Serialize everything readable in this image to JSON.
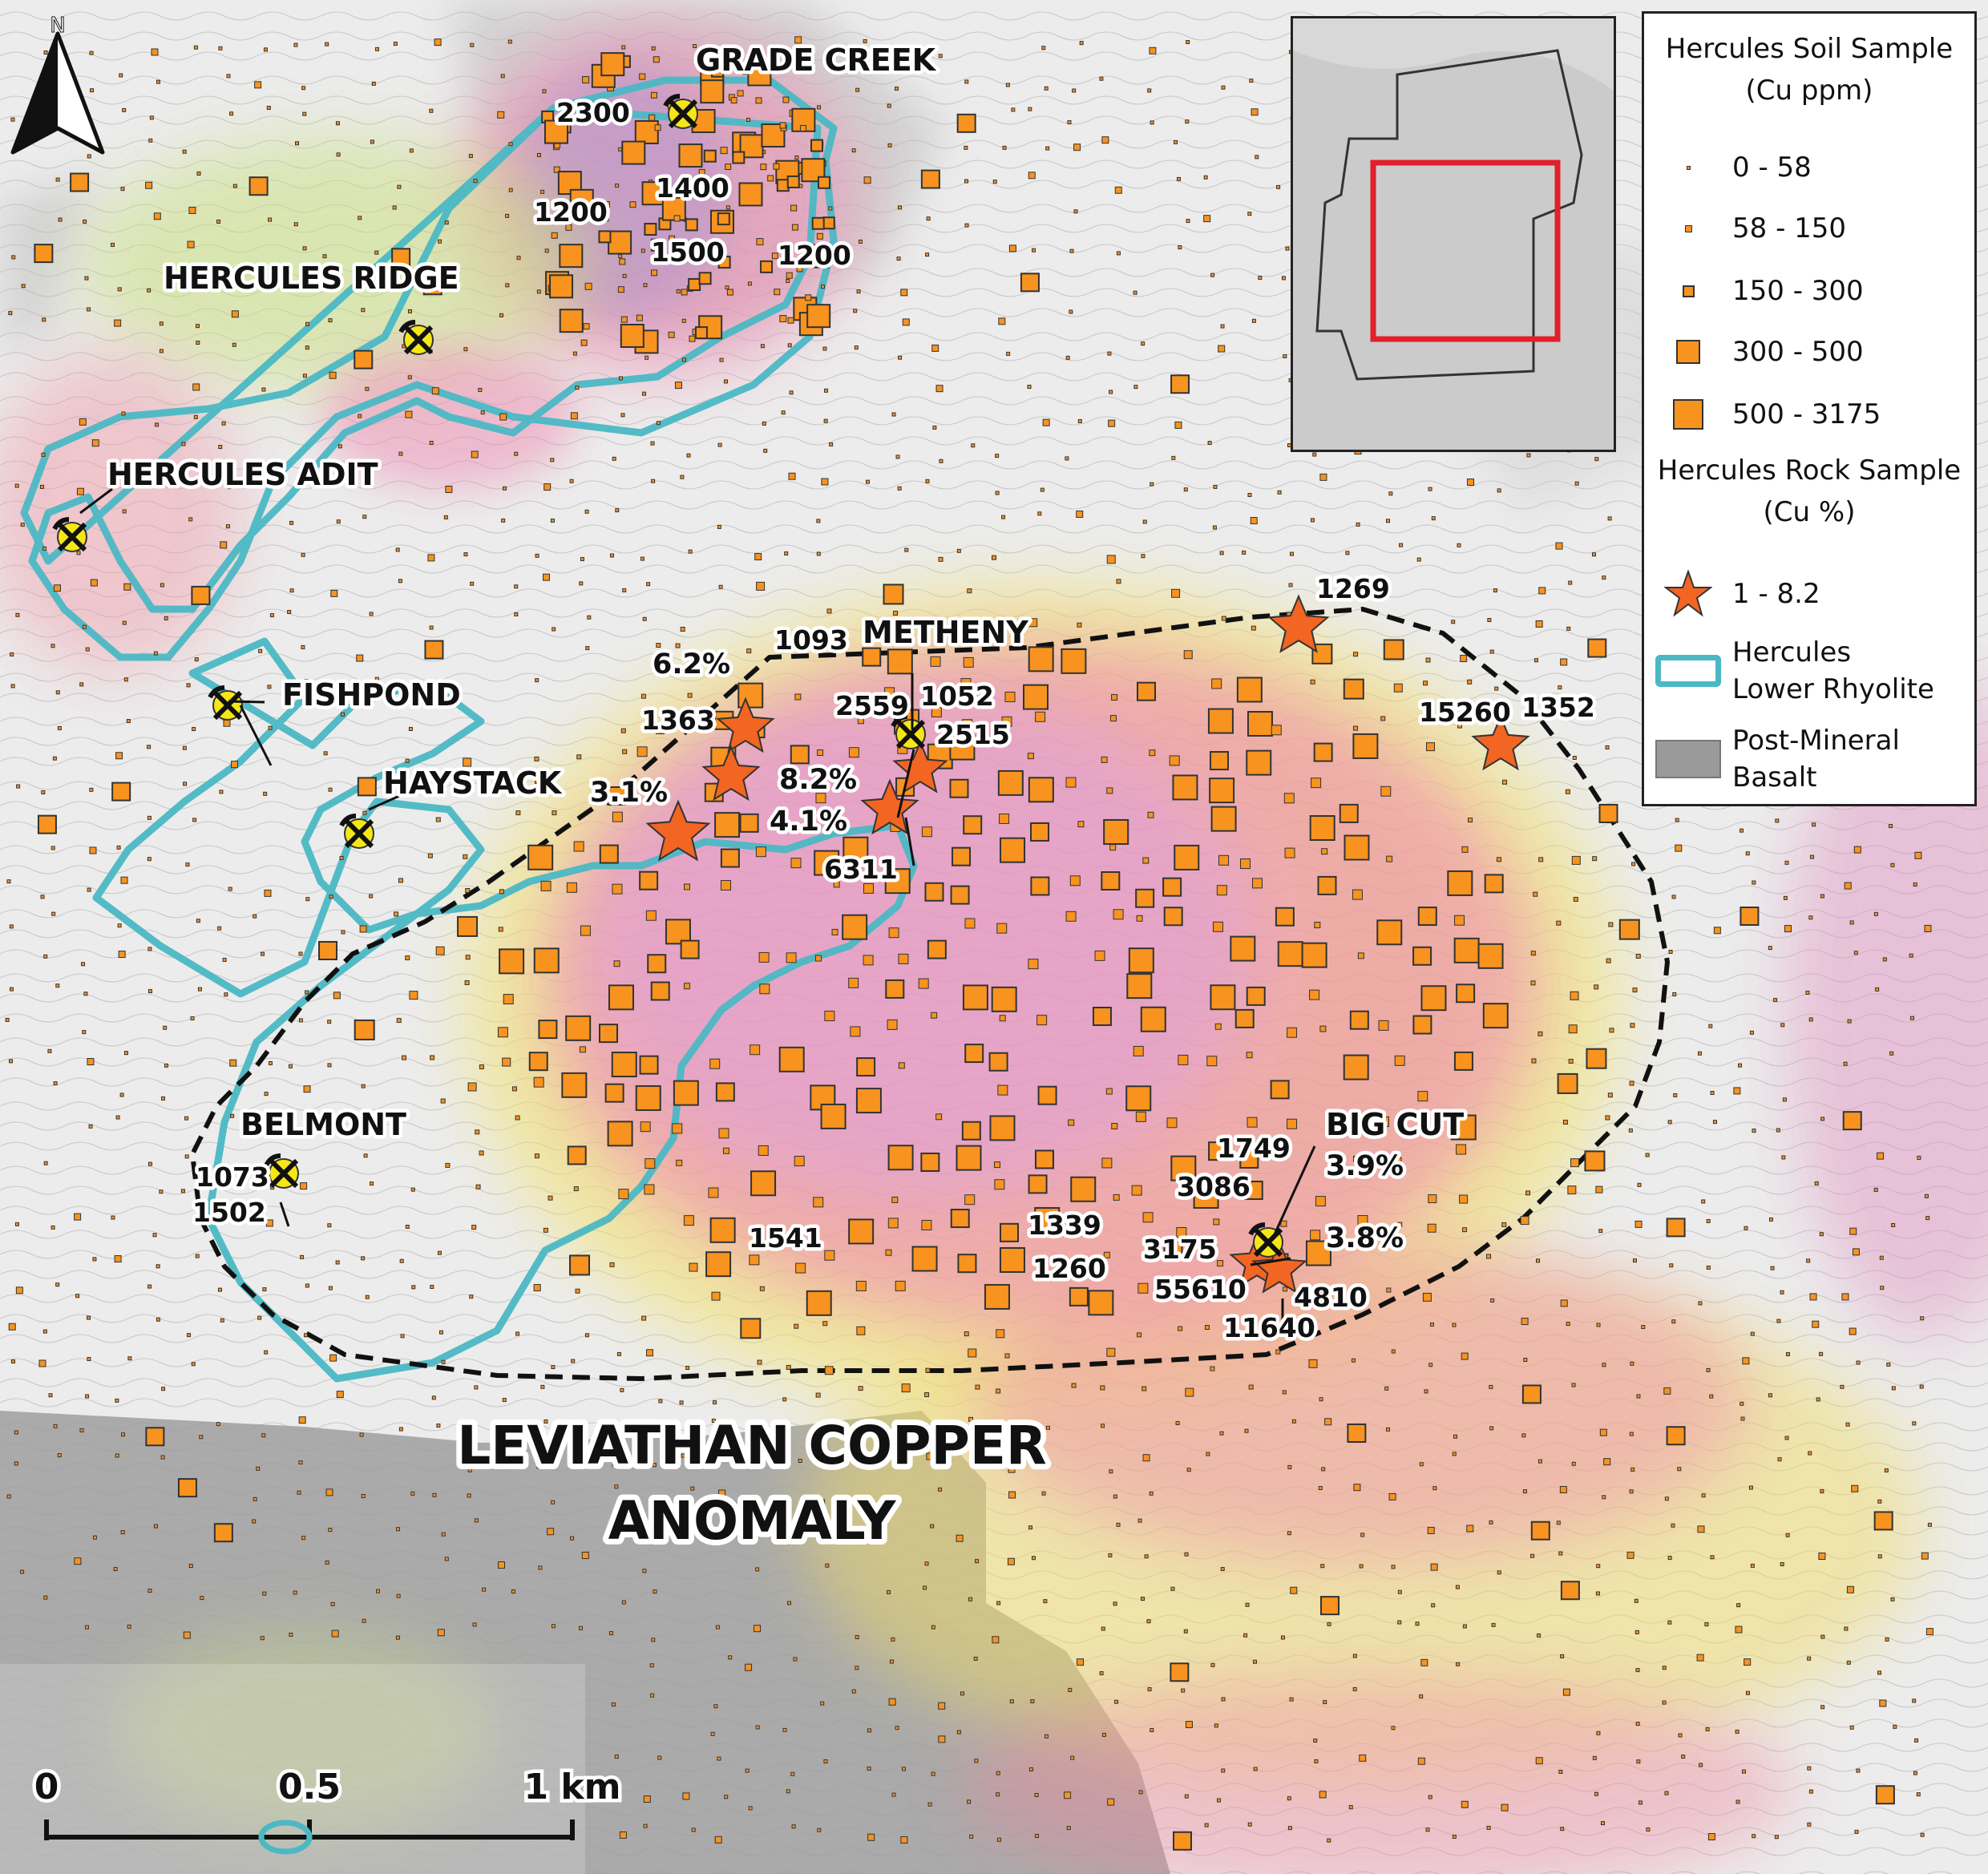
{
  "title": {
    "line1": "LEVIATHAN COPPER",
    "line2": "ANOMALY"
  },
  "north_arrow": {
    "label": "N",
    "icon": "north-arrow-icon"
  },
  "scale_bar": {
    "labels": [
      "0",
      "0.5",
      "1 km"
    ]
  },
  "colors": {
    "soil_fill": "#f7931e",
    "rock_star": "#f26522",
    "rhyolite_outline": "#4bb8c4",
    "basalt_fill": "#9a9a9a",
    "anomaly_outline": "#111111",
    "inset_frame": "#e0202a",
    "mine_symbol": "#f5e617"
  },
  "legend": {
    "soil_heading": [
      "Hercules Soil Sample",
      "(Cu ppm)"
    ],
    "soil_classes": [
      "0 - 58",
      "58 - 150",
      "150 - 300",
      "300 - 500",
      "500 - 3175"
    ],
    "rock_heading": [
      "Hercules Rock Sample",
      "(Cu %)"
    ],
    "rock_classes": [
      "1 - 8.2"
    ],
    "rhyolite_label": [
      "Hercules",
      "Lower Rhyolite"
    ],
    "basalt_label": [
      "Post-Mineral",
      "Basalt"
    ]
  },
  "mines": [
    {
      "name": "GRADE CREEK",
      "icon": "mine-pick-hammer-icon"
    },
    {
      "name": "HERCULES RIDGE",
      "icon": "mine-pick-hammer-icon"
    },
    {
      "name": "HERCULES ADIT",
      "icon": "mine-pick-hammer-icon"
    },
    {
      "name": "FISHPOND",
      "icon": "mine-pick-hammer-icon"
    },
    {
      "name": "HAYSTACK",
      "icon": "mine-pick-hammer-icon"
    },
    {
      "name": "METHENY",
      "icon": "mine-pick-hammer-icon"
    },
    {
      "name": "BELMONT",
      "icon": "mine-pick-hammer-icon"
    },
    {
      "name": "BIG CUT",
      "icon": "mine-pick-hammer-icon"
    }
  ],
  "soil_values": [
    "2300",
    "1400",
    "1200",
    "1500",
    "1200",
    "1093",
    "1363",
    "2559",
    "1052",
    "2515",
    "6311",
    "1269",
    "15260",
    "1352",
    "1073",
    "1502",
    "1541",
    "1339",
    "1260",
    "3175",
    "1749",
    "3086",
    "55610",
    "4810",
    "11640"
  ],
  "rock_values": [
    "6.2%",
    "8.2%",
    "3.1%",
    "4.1%",
    "3.9%",
    "3.8%"
  ]
}
